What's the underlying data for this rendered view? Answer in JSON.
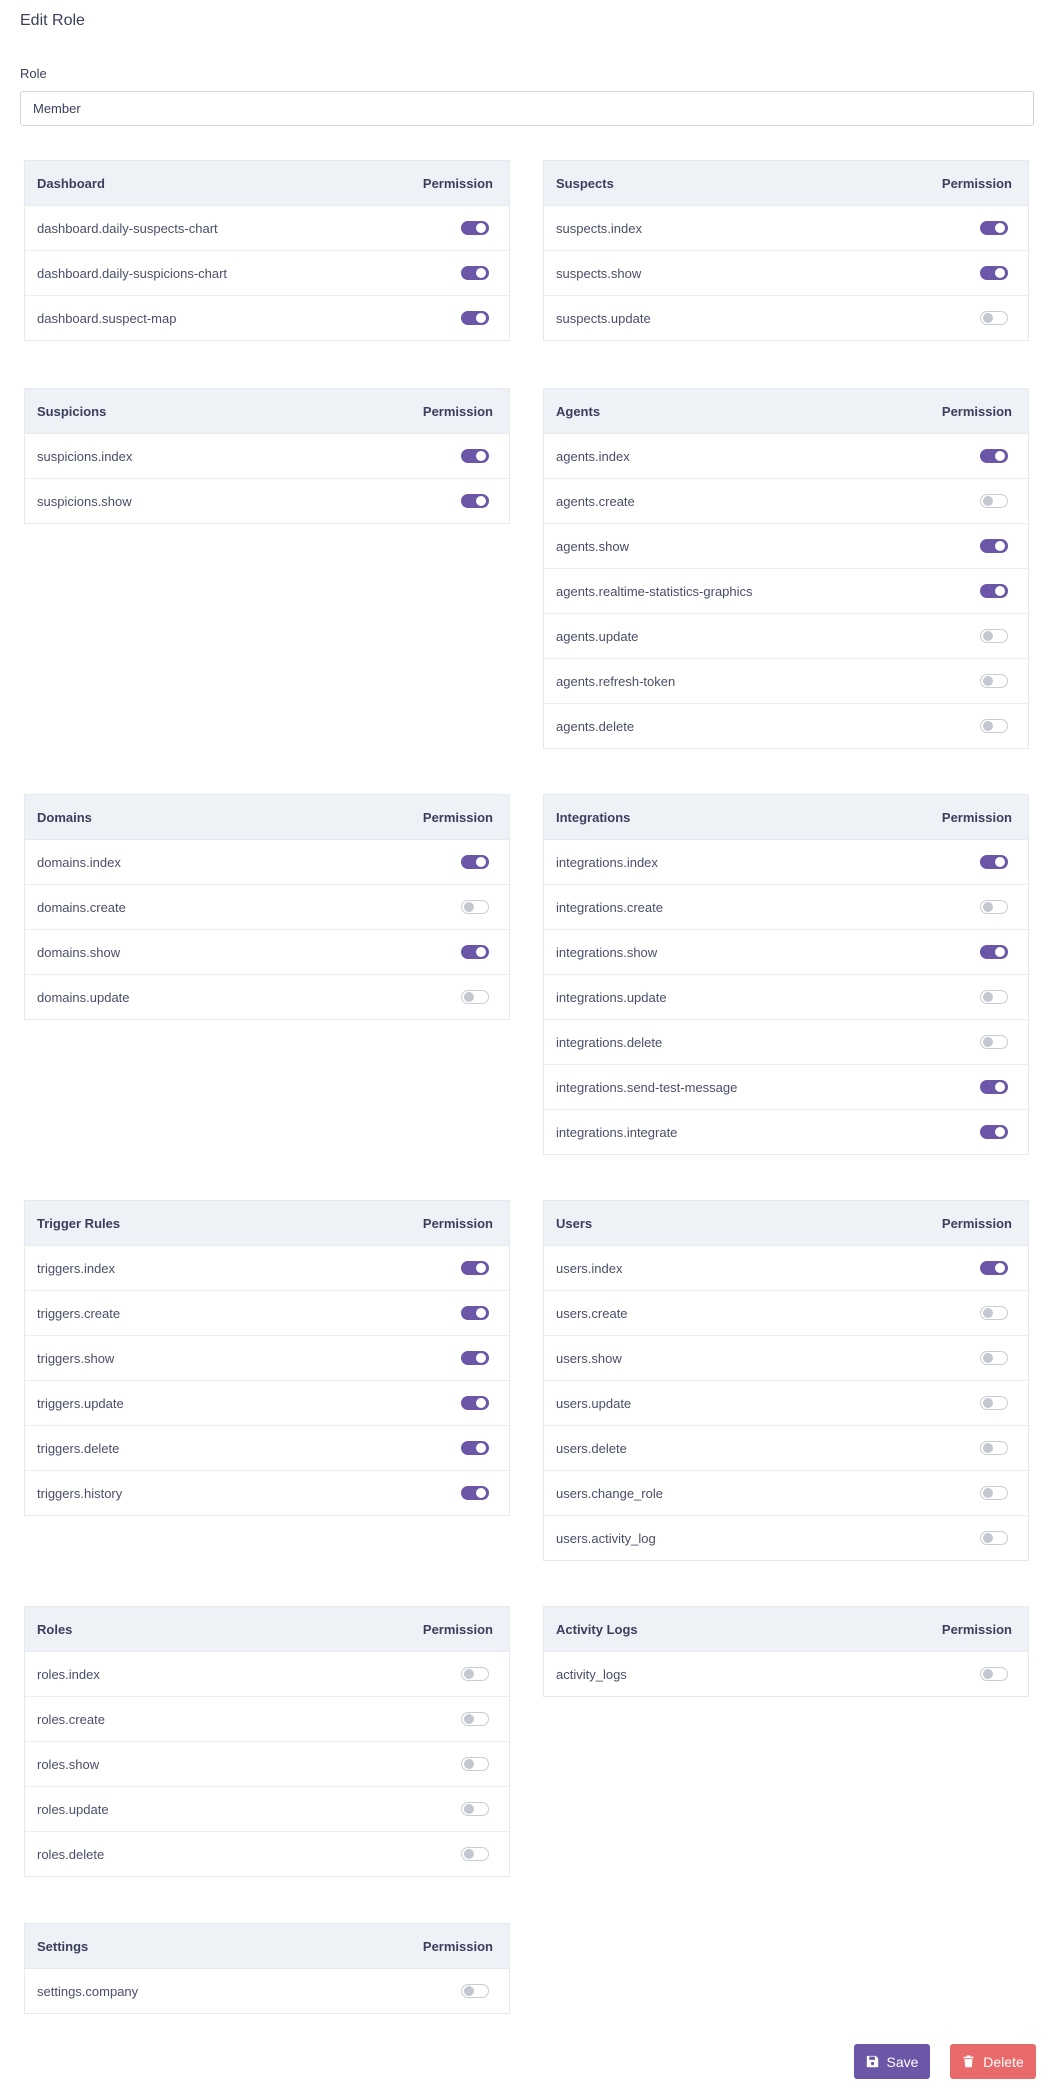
{
  "page": {
    "title": "Edit Role"
  },
  "role": {
    "label": "Role",
    "value": "Member"
  },
  "column_header": "Permission",
  "sections": [
    {
      "title": "Dashboard",
      "permissions": [
        {
          "name": "dashboard.daily-suspects-chart",
          "enabled": true
        },
        {
          "name": "dashboard.daily-suspicions-chart",
          "enabled": true
        },
        {
          "name": "dashboard.suspect-map",
          "enabled": true
        }
      ]
    },
    {
      "title": "Suspects",
      "permissions": [
        {
          "name": "suspects.index",
          "enabled": true
        },
        {
          "name": "suspects.show",
          "enabled": true
        },
        {
          "name": "suspects.update",
          "enabled": false
        }
      ]
    },
    {
      "title": "Suspicions",
      "permissions": [
        {
          "name": "suspicions.index",
          "enabled": true
        },
        {
          "name": "suspicions.show",
          "enabled": true
        }
      ]
    },
    {
      "title": "Agents",
      "permissions": [
        {
          "name": "agents.index",
          "enabled": true
        },
        {
          "name": "agents.create",
          "enabled": false
        },
        {
          "name": "agents.show",
          "enabled": true
        },
        {
          "name": "agents.realtime-statistics-graphics",
          "enabled": true
        },
        {
          "name": "agents.update",
          "enabled": false
        },
        {
          "name": "agents.refresh-token",
          "enabled": false
        },
        {
          "name": "agents.delete",
          "enabled": false
        }
      ]
    },
    {
      "title": "Domains",
      "permissions": [
        {
          "name": "domains.index",
          "enabled": true
        },
        {
          "name": "domains.create",
          "enabled": false
        },
        {
          "name": "domains.show",
          "enabled": true
        },
        {
          "name": "domains.update",
          "enabled": false
        }
      ]
    },
    {
      "title": "Integrations",
      "permissions": [
        {
          "name": "integrations.index",
          "enabled": true
        },
        {
          "name": "integrations.create",
          "enabled": false
        },
        {
          "name": "integrations.show",
          "enabled": true
        },
        {
          "name": "integrations.update",
          "enabled": false
        },
        {
          "name": "integrations.delete",
          "enabled": false
        },
        {
          "name": "integrations.send-test-message",
          "enabled": true
        },
        {
          "name": "integrations.integrate",
          "enabled": true
        }
      ]
    },
    {
      "title": "Trigger Rules",
      "permissions": [
        {
          "name": "triggers.index",
          "enabled": true
        },
        {
          "name": "triggers.create",
          "enabled": true
        },
        {
          "name": "triggers.show",
          "enabled": true
        },
        {
          "name": "triggers.update",
          "enabled": true
        },
        {
          "name": "triggers.delete",
          "enabled": true
        },
        {
          "name": "triggers.history",
          "enabled": true
        }
      ]
    },
    {
      "title": "Users",
      "permissions": [
        {
          "name": "users.index",
          "enabled": true
        },
        {
          "name": "users.create",
          "enabled": false
        },
        {
          "name": "users.show",
          "enabled": false
        },
        {
          "name": "users.update",
          "enabled": false
        },
        {
          "name": "users.delete",
          "enabled": false
        },
        {
          "name": "users.change_role",
          "enabled": false
        },
        {
          "name": "users.activity_log",
          "enabled": false
        }
      ]
    },
    {
      "title": "Roles",
      "permissions": [
        {
          "name": "roles.index",
          "enabled": false
        },
        {
          "name": "roles.create",
          "enabled": false
        },
        {
          "name": "roles.show",
          "enabled": false
        },
        {
          "name": "roles.update",
          "enabled": false
        },
        {
          "name": "roles.delete",
          "enabled": false
        }
      ]
    },
    {
      "title": "Activity Logs",
      "permissions": [
        {
          "name": "activity_logs",
          "enabled": false
        }
      ]
    },
    {
      "title": "Settings",
      "permissions": [
        {
          "name": "settings.company",
          "enabled": false
        }
      ]
    }
  ],
  "actions": {
    "save_label": "Save",
    "delete_label": "Delete",
    "save_icon": "floppy-disk-icon",
    "delete_icon": "trash-icon"
  },
  "colors": {
    "accent": "#6b56a7",
    "danger": "#e86a6a",
    "header_bg": "#eef1f6"
  }
}
